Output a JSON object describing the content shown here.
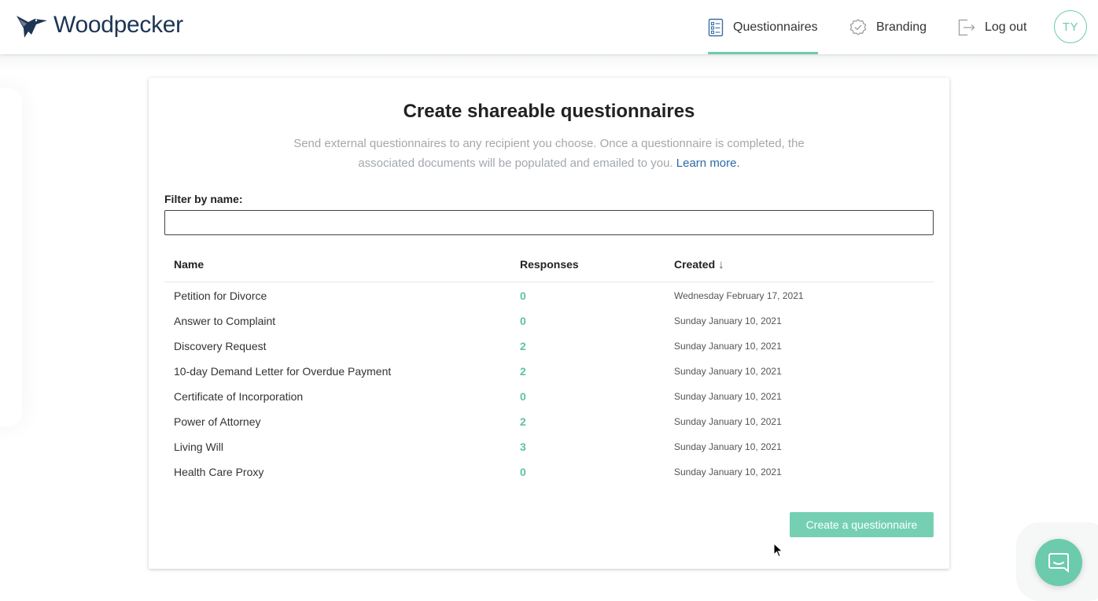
{
  "brand": {
    "name": "Woodpecker",
    "color": "#1e3553",
    "accent": "#6ccbac"
  },
  "nav": {
    "items": [
      {
        "label": "Questionnaires",
        "icon": "list-document-icon",
        "active": true
      },
      {
        "label": "Branding",
        "icon": "badge-check-icon",
        "active": false
      },
      {
        "label": "Log out",
        "icon": "logout-icon",
        "active": false
      }
    ],
    "avatar": "TY"
  },
  "main": {
    "title": "Create shareable questionnaires",
    "subtitle": "Send external questionnaires to any recipient you choose. Once a questionnaire is completed, the associated documents will be populated and emailed to you.",
    "learn_more": "Learn more.",
    "filter_label": "Filter by name:",
    "filter_value": "",
    "filter_placeholder": ""
  },
  "table": {
    "headers": {
      "name": "Name",
      "responses": "Responses",
      "created": "Created",
      "sort_indicator": "↓"
    },
    "rows": [
      {
        "name": "Petition for Divorce",
        "responses": "0",
        "created": "Wednesday February 17, 2021"
      },
      {
        "name": "Answer to Complaint",
        "responses": "0",
        "created": "Sunday January 10, 2021"
      },
      {
        "name": "Discovery Request",
        "responses": "2",
        "created": "Sunday January 10, 2021"
      },
      {
        "name": "10-day Demand Letter for Overdue Payment",
        "responses": "2",
        "created": "Sunday January 10, 2021"
      },
      {
        "name": "Certificate of Incorporation",
        "responses": "0",
        "created": "Sunday January 10, 2021"
      },
      {
        "name": "Power of Attorney",
        "responses": "2",
        "created": "Sunday January 10, 2021"
      },
      {
        "name": "Living Will",
        "responses": "3",
        "created": "Sunday January 10, 2021"
      },
      {
        "name": "Health Care Proxy",
        "responses": "0",
        "created": "Sunday January 10, 2021"
      }
    ]
  },
  "actions": {
    "create_label": "Create a questionnaire"
  },
  "chat": {
    "icon": "chat-bubble-icon"
  }
}
